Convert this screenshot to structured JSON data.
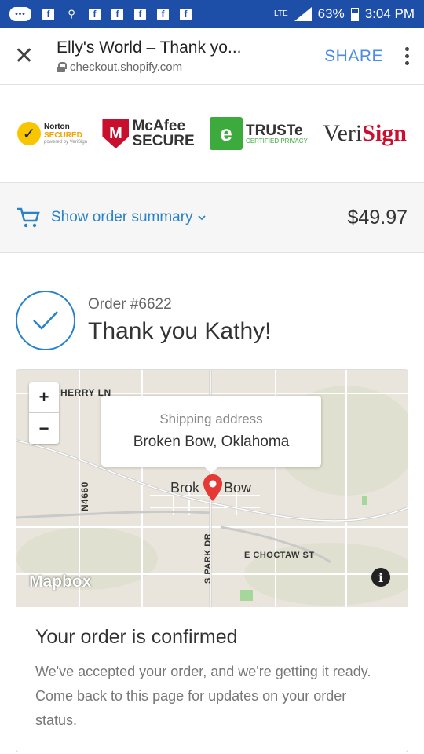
{
  "status_bar": {
    "network": "LTE",
    "battery": "63%",
    "time": "3:04 PM"
  },
  "browser": {
    "title": "Elly's World – Thank yo...",
    "url": "checkout.shopify.com",
    "share_label": "SHARE"
  },
  "trust_badges": {
    "norton": {
      "name": "Norton",
      "status": "SECURED",
      "sub": "powered by VeriSign"
    },
    "mcafee": {
      "line1": "McAfee",
      "line2": "SECURE"
    },
    "truste": {
      "name": "TRUSTe",
      "sub": "CERTIFIED PRIVACY"
    },
    "verisign": {
      "prefix": "Veri",
      "suffix": "Sign"
    }
  },
  "summary": {
    "label": "Show order summary",
    "total": "$49.97"
  },
  "order": {
    "number": "Order #6622",
    "thanks": "Thank you Kathy!"
  },
  "map": {
    "popup_label": "Shipping address",
    "popup_value": "Broken Bow, Oklahoma",
    "city_left": "Brok",
    "city_right": "Bow",
    "street_cherry": "HERRY LN",
    "street_n4660": "N4660",
    "street_spark": "S PARK DR",
    "street_choctaw": "E CHOCTAW ST",
    "attribution": "Mapbox",
    "zoom_in": "+",
    "zoom_out": "−",
    "info": "i"
  },
  "confirmation": {
    "heading": "Your order is confirmed",
    "body": "We've accepted your order, and we're getting it ready. Come back to this page for updates on your order status."
  },
  "colors": {
    "status_bar": "#1e4fa8",
    "link_blue": "#2a82c8",
    "share_blue": "#4a8ce6",
    "pin_red": "#e53935"
  }
}
